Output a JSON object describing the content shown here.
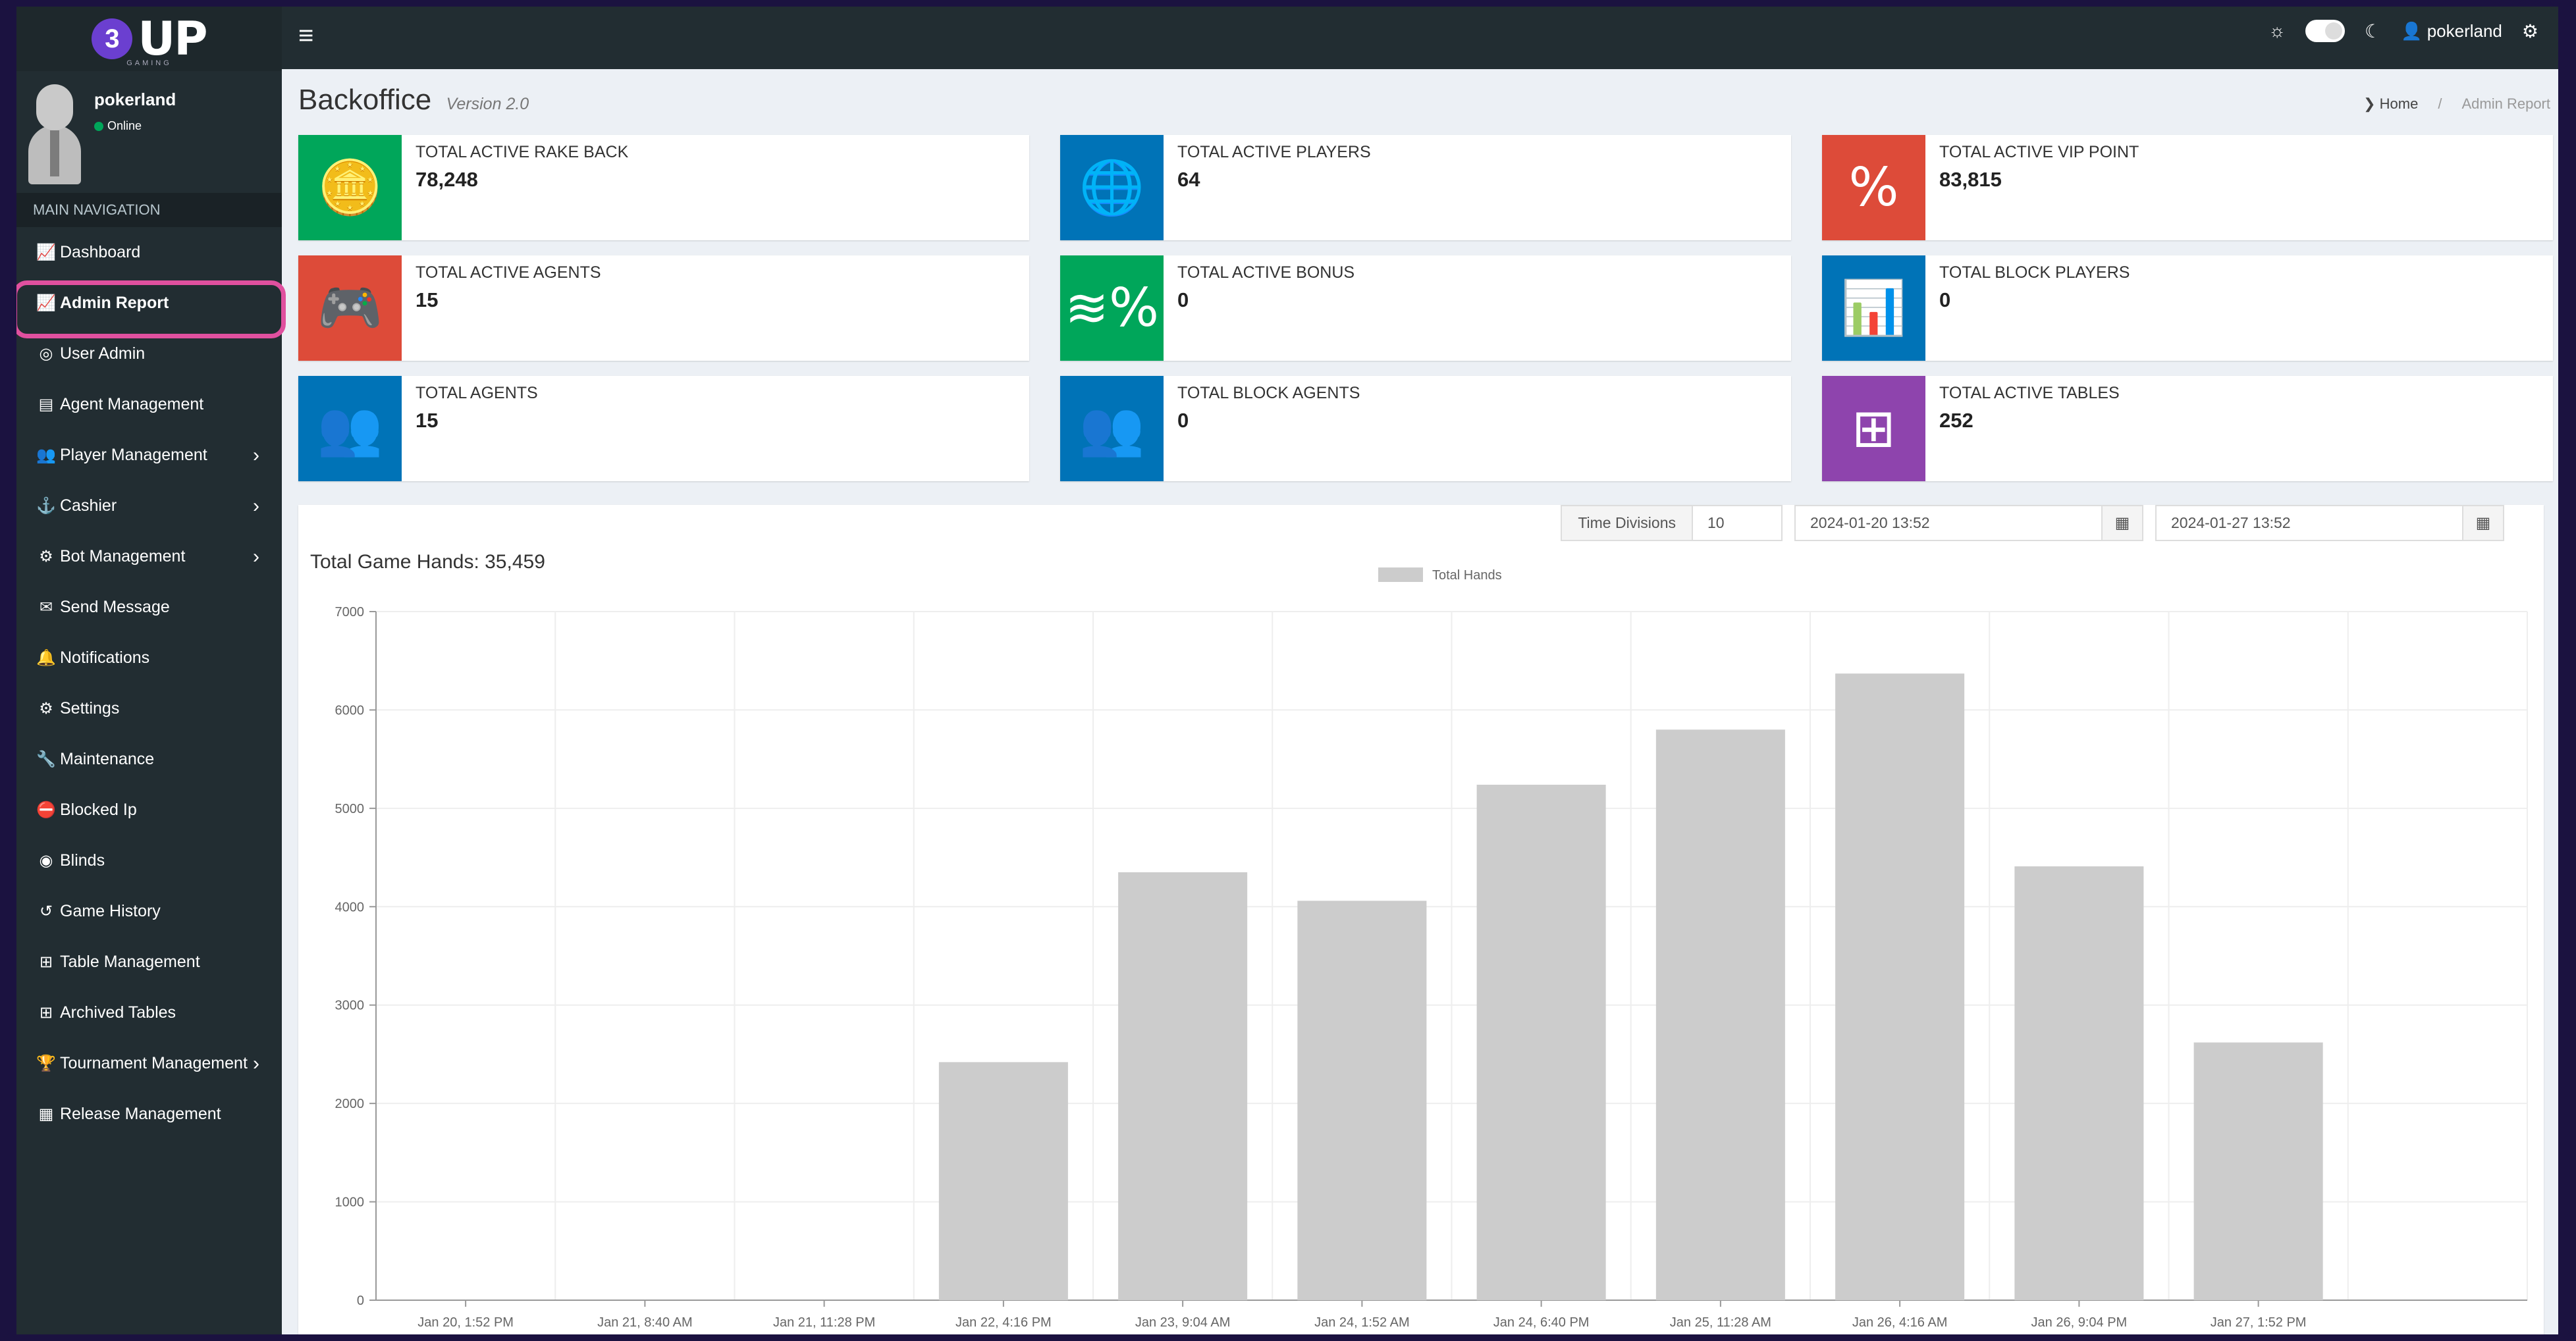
{
  "logo": {
    "badge": "3",
    "text": "UP",
    "sub": "GAMING"
  },
  "user": {
    "name": "pokerland",
    "status": "Online"
  },
  "nav": {
    "header": "MAIN NAVIGATION",
    "items": [
      {
        "label": "Dashboard",
        "icon": "chart-icon"
      },
      {
        "label": "Admin Report",
        "icon": "chart-icon"
      },
      {
        "label": "User Admin",
        "icon": "user-icon"
      },
      {
        "label": "Agent Management",
        "icon": "agent-icon"
      },
      {
        "label": "Player Management",
        "icon": "users-icon"
      },
      {
        "label": "Cashier",
        "icon": "cashier-icon"
      },
      {
        "label": "Bot Management",
        "icon": "bot-icon"
      },
      {
        "label": "Send Message",
        "icon": "envelope-icon"
      },
      {
        "label": "Notifications",
        "icon": "bell-icon"
      },
      {
        "label": "Settings",
        "icon": "gear-icon"
      },
      {
        "label": "Maintenance",
        "icon": "wrench-icon"
      },
      {
        "label": "Blocked Ip",
        "icon": "block-user-icon"
      },
      {
        "label": "Blinds",
        "icon": "blinds-icon"
      },
      {
        "label": "Game History",
        "icon": "history-icon"
      },
      {
        "label": "Table Management",
        "icon": "table-icon"
      },
      {
        "label": "Archived Tables",
        "icon": "table-icon"
      },
      {
        "label": "Tournament Management",
        "icon": "trophy-icon"
      },
      {
        "label": "Release Management",
        "icon": "newspaper-icon"
      }
    ]
  },
  "topbar": {
    "username": "pokerland"
  },
  "page": {
    "title": "Backoffice",
    "version": "Version 2.0",
    "breadcrumb": {
      "home": "Home",
      "current": "Admin Report"
    }
  },
  "cards": [
    {
      "label": "TOTAL ACTIVE RAKE BACK",
      "value": "78,248",
      "icon": "coins-icon",
      "color": "#00a65a"
    },
    {
      "label": "TOTAL ACTIVE PLAYERS",
      "value": "64",
      "icon": "globe-icon",
      "color": "#0073b7"
    },
    {
      "label": "TOTAL ACTIVE VIP POINT",
      "value": "83,815",
      "icon": "percent-icon",
      "color": "#dd4b39"
    },
    {
      "label": "TOTAL ACTIVE AGENTS",
      "value": "15",
      "icon": "gamepad-icon",
      "color": "#dd4b39"
    },
    {
      "label": "TOTAL ACTIVE BONUS",
      "value": "0",
      "icon": "money-percent-icon",
      "color": "#00a65a"
    },
    {
      "label": "TOTAL BLOCK PLAYERS",
      "value": "0",
      "icon": "bar-chart-icon",
      "color": "#0073b7"
    },
    {
      "label": "TOTAL AGENTS",
      "value": "15",
      "icon": "group-icon",
      "color": "#0073b7"
    },
    {
      "label": "TOTAL BLOCK AGENTS",
      "value": "0",
      "icon": "group-icon",
      "color": "#0073b7"
    },
    {
      "label": "TOTAL ACTIVE TABLES",
      "value": "252",
      "icon": "grid-icon",
      "color": "#8e44ad"
    }
  ],
  "controls": {
    "time_divisions_label": "Time Divisions",
    "time_divisions_value": "10",
    "start_date": "2024-01-20 13:52",
    "end_date": "2024-01-27 13:52"
  },
  "chart_title": "Total Game Hands: 35,459",
  "chart_data": {
    "type": "bar",
    "categories": [
      "Jan 20, 1:52 PM",
      "Jan 21, 8:40 AM",
      "Jan 21, 11:28 PM",
      "Jan 22, 4:16 PM",
      "Jan 23, 9:04 AM",
      "Jan 24, 1:52 AM",
      "Jan 24, 6:40 PM",
      "Jan 25, 11:28 AM",
      "Jan 26, 4:16 AM",
      "Jan 26, 9:04 PM",
      "Jan 27, 1:52 PM"
    ],
    "series": [
      {
        "name": "Total Hands",
        "values": [
          0,
          0,
          0,
          2420,
          4350,
          4060,
          5240,
          5800,
          6370,
          4410,
          2620,
          0
        ]
      }
    ],
    "ylim": [
      0,
      7000
    ],
    "yticks": [
      0,
      1000,
      2000,
      3000,
      4000,
      5000,
      6000,
      7000
    ],
    "bar_color": "#cccccc",
    "legend": "top"
  }
}
